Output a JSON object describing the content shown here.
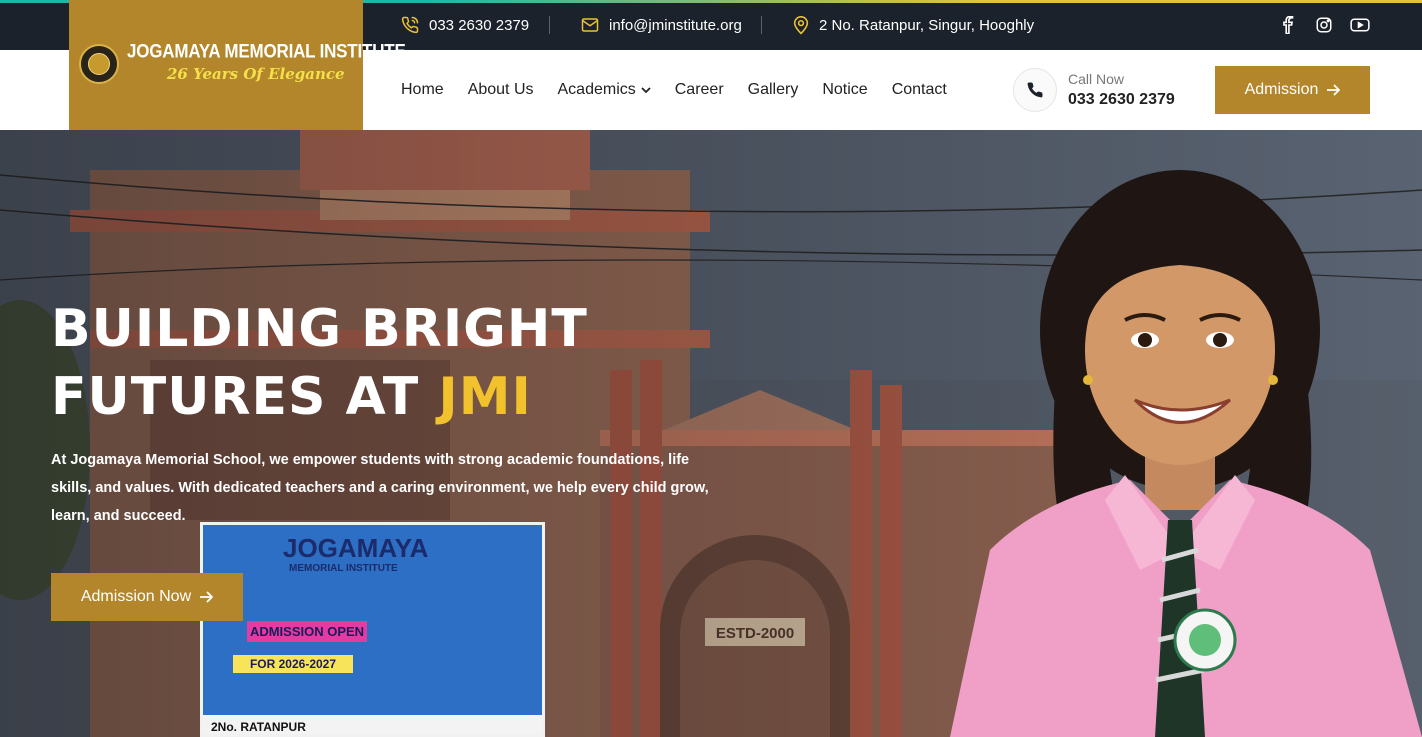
{
  "topbar": {
    "phone": "033 2630 2379",
    "email": "info@jminstitute.org",
    "address": "2 No. Ratanpur, Singur, Hooghly",
    "socials": [
      "facebook-icon",
      "instagram-icon",
      "youtube-icon"
    ]
  },
  "logo": {
    "name": "JOGAMAYA MEMORIAL INSTITUTE",
    "tagline": "26 Years Of Elegance"
  },
  "nav": {
    "items": [
      "Home",
      "About Us",
      "Academics",
      "Career",
      "Gallery",
      "Notice",
      "Contact"
    ]
  },
  "call": {
    "label": "Call Now",
    "number": "033 2630 2379"
  },
  "admission_label": "Admission",
  "hero": {
    "title_line1": "BUILDING BRIGHT",
    "title_line2": "FUTURES AT",
    "title_highlight": "JMI",
    "description": "At Jogamaya Memorial School, we empower students with strong academic foundations, life skills, and values. With dedicated teachers and a caring environment, we help every child grow, learn, and succeed.",
    "cta_label": "Admission Now",
    "banner": {
      "title": "JOGAMAYA",
      "subtitle": "MEMORIAL INSTITUTE",
      "admission": "ADMISSION OPEN",
      "year": "FOR 2026-2027",
      "location": "2No. RATANPUR"
    }
  },
  "colors": {
    "brand_gold": "#b3862b",
    "highlight_yellow": "#f2c12e",
    "topbar_dark": "#1c222b"
  }
}
